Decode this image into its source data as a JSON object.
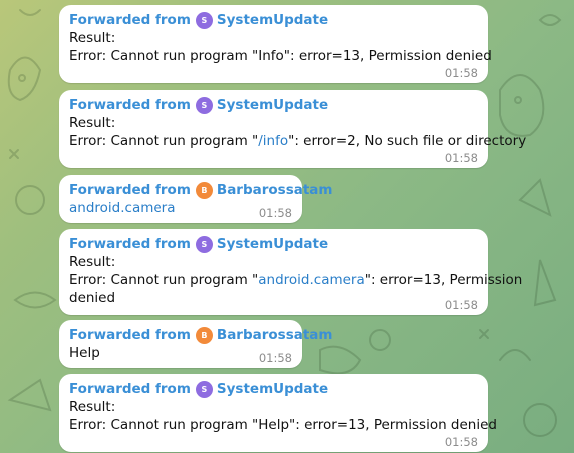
{
  "colors": {
    "systemupdate_avatar": "#8e6ce0",
    "barbarossatam_avatar": "#f28a3a",
    "forward_name": "#3a8fd6",
    "link": "#2a7ec8"
  },
  "messages": [
    {
      "forwarded_prefix": "Forwarded from",
      "sender": "SystemUpdate",
      "avatar_letter": "S",
      "lines": [
        [
          "Result:"
        ],
        [
          "Error: Cannot run program \"Info\": error=13, Permission denied"
        ]
      ],
      "time": "01:58"
    },
    {
      "forwarded_prefix": "Forwarded from",
      "sender": "SystemUpdate",
      "avatar_letter": "S",
      "lines": [
        [
          "Result:"
        ],
        [
          "Error: Cannot run program \"",
          "/info",
          "\": error=2, No such file or directory"
        ]
      ],
      "time": "01:58"
    },
    {
      "forwarded_prefix": "Forwarded from",
      "sender": "Barbarossatam",
      "avatar_letter": "B",
      "lines": [
        [
          "",
          "android.camera"
        ]
      ],
      "time": "01:58"
    },
    {
      "forwarded_prefix": "Forwarded from",
      "sender": "SystemUpdate",
      "avatar_letter": "S",
      "lines": [
        [
          "Result:"
        ],
        [
          "Error: Cannot run program \"",
          "android.camera",
          "\": error=13, Permission"
        ],
        [
          "denied"
        ]
      ],
      "time": "01:58"
    },
    {
      "forwarded_prefix": "Forwarded from",
      "sender": "Barbarossatam",
      "avatar_letter": "B",
      "lines": [
        [
          "Help"
        ]
      ],
      "time": "01:58"
    },
    {
      "forwarded_prefix": "Forwarded from",
      "sender": "SystemUpdate",
      "avatar_letter": "S",
      "lines": [
        [
          "Result:"
        ],
        [
          "Error: Cannot run program \"Help\": error=13, Permission denied"
        ]
      ],
      "time": "01:58"
    }
  ]
}
